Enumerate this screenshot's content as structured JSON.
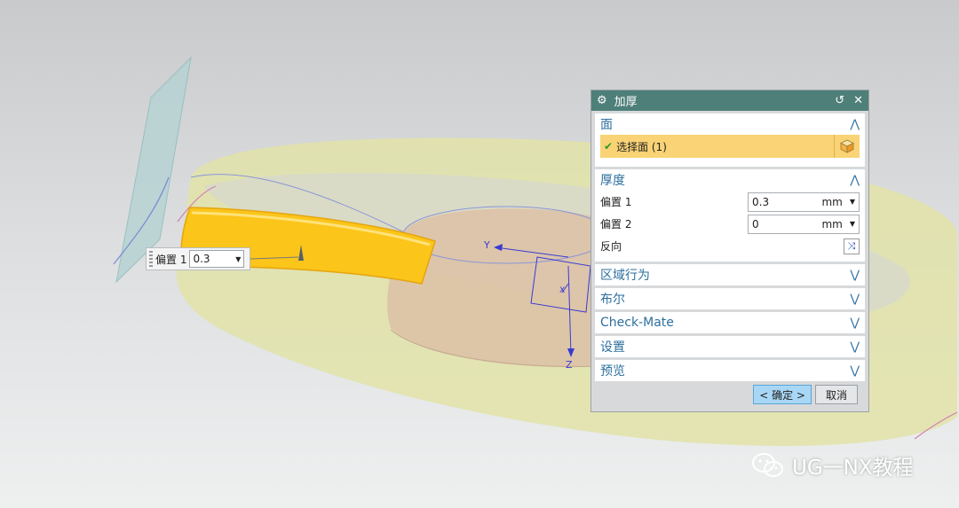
{
  "viewport": {
    "axis_labels": {
      "y": "Y",
      "x": "X",
      "z": "Z"
    }
  },
  "float_input": {
    "label": "偏置 1",
    "value": "0.3"
  },
  "dialog": {
    "title": "加厚",
    "sections": {
      "face": {
        "header": "面",
        "select_label": "选择面 (1)"
      },
      "thickness": {
        "header": "厚度",
        "offset1": {
          "label": "偏置 1",
          "value": "0.3",
          "unit": "mm"
        },
        "offset2": {
          "label": "偏置 2",
          "value": "0",
          "unit": "mm"
        },
        "reverse_label": "反向"
      },
      "region": {
        "header": "区域行为"
      },
      "boolean": {
        "header": "布尔"
      },
      "checkmate": {
        "header": "Check-Mate"
      },
      "settings": {
        "header": "设置"
      },
      "preview": {
        "header": "预览"
      }
    },
    "ok_label": "< 确定 >",
    "cancel_label": "取消"
  },
  "watermark": {
    "text": "UG一NX教程"
  },
  "colors": {
    "titlebar": "#4e7f79",
    "section_header": "#2d6f9e",
    "selection": "#f9d375",
    "body_yellow": "#fbc51a",
    "ring": "#e2e3a8"
  }
}
